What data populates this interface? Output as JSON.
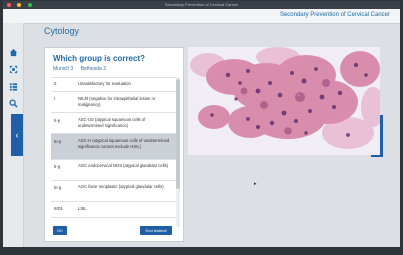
{
  "window": {
    "title": "Secondary Prevention of Cervical Cancer"
  },
  "header": {
    "title": "Secondary Prevention of Cervical Cancer"
  },
  "sidebar": {
    "items": [
      {
        "icon": "home-icon"
      },
      {
        "icon": "expand-icon"
      },
      {
        "icon": "list-icon"
      },
      {
        "icon": "search-icon"
      }
    ]
  },
  "page": {
    "title": "Cytology"
  },
  "quiz": {
    "question": "Which group is correct?",
    "col1": "Munich 3",
    "col2": "Bethesda 2",
    "rows": [
      {
        "code": "0",
        "desc": "Unsatisfactory for evaluation"
      },
      {
        "code": "I",
        "desc": "NILM (negative for intraepithelial lesion or malignancy)"
      },
      {
        "code": "II-p",
        "desc": "ASC-US (atypical squamous cells of undetermined significance)"
      },
      {
        "code": "III-p",
        "desc": "ASC-H (atypical squamous cells of undetermined significance cannot exclude HSIL)"
      },
      {
        "code": "II-g",
        "desc": "AGC endocervical NOS (atypical glandular cells)"
      },
      {
        "code": "III-g",
        "desc": "AGC favor neoplastic (atypical glandular cells)"
      },
      {
        "code": "IIID1",
        "desc": "LSIL"
      }
    ],
    "ok": "OK",
    "end": "End testtest"
  },
  "colors": {
    "accent": "#1f6aa5",
    "button": "#1f5fa6",
    "selected_row": "#cbd0d6"
  }
}
